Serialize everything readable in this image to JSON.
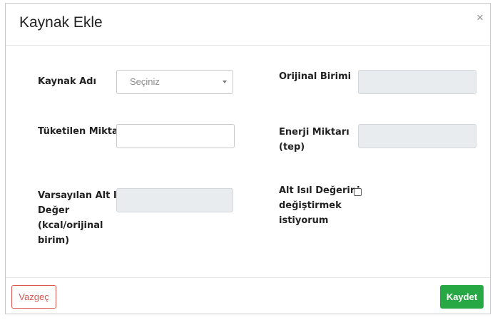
{
  "modal": {
    "title": "Kaynak Ekle",
    "close_symbol": "×"
  },
  "form": {
    "kaynak_adi": {
      "label": "Kaynak Adı",
      "placeholder": "Seçiniz"
    },
    "orijinal_birimi": {
      "label": "Orijinal Birimi",
      "value": ""
    },
    "tuketilen_miktar": {
      "label": "Tüketilen Miktar",
      "value": ""
    },
    "enerji_miktari": {
      "label_line1": "Enerji Miktarı",
      "label_line2": "(tep)",
      "value": ""
    },
    "varsayilan": {
      "label_line1": "Varsayılan Alt Isıl",
      "label_line2": "Değer",
      "label_line3": "(kcal/orijinal",
      "label_line4": "birim)",
      "value": ""
    },
    "alt_isil_toggle": {
      "label_line1": "Alt Isıl Değerini",
      "label_line2": "değiştirmek",
      "label_line3": "istiyorum",
      "checked": false
    }
  },
  "footer": {
    "cancel_label": "Vazgeç",
    "save_label": "Kaydet"
  },
  "colors": {
    "danger": "#d9534f",
    "success": "#28a745",
    "readonly_bg": "#e9ecef"
  }
}
